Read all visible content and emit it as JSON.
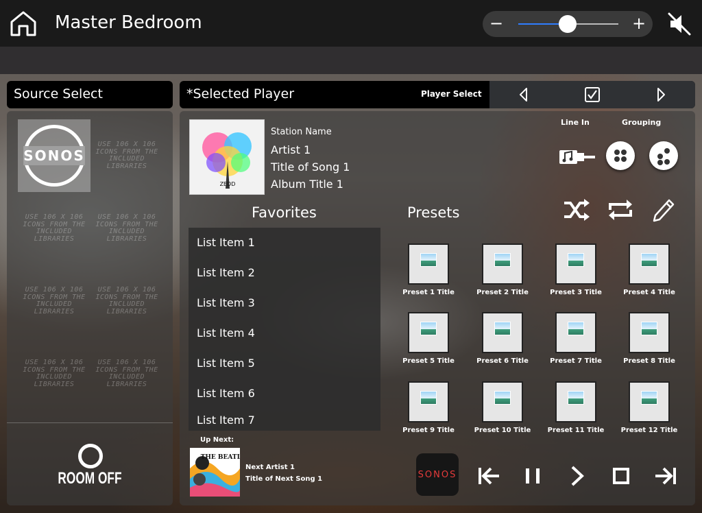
{
  "header": {
    "room_name": "Master Bedroom",
    "volume": {
      "minus": "−",
      "plus": "+",
      "level": 0.49
    }
  },
  "source_select": {
    "title": "Source Select",
    "tiles": [
      "SONOS",
      "USE 106 X 106 ICONS FROM THE INCLUDED LIBRARIES",
      "USE 106 X 106 ICONS FROM THE INCLUDED LIBRARIES",
      "USE 106 X 106 ICONS FROM THE INCLUDED LIBRARIES",
      "USE 106 X 106 ICONS FROM THE INCLUDED LIBRARIES",
      "USE 106 X 106 ICONS FROM THE INCLUDED LIBRARIES",
      "USE 106 X 106 ICONS FROM THE INCLUDED LIBRARIES",
      "USE 106 X 106 ICONS FROM THE INCLUDED LIBRARIES"
    ],
    "room_off": "ROOM OFF"
  },
  "player": {
    "title": "*Selected Player",
    "player_select": "Player Select"
  },
  "now_playing": {
    "album_text": "ZEDD",
    "station": "Station Name",
    "artist": "Artist 1",
    "song": "Title of Song 1",
    "album": "Album Title 1"
  },
  "labels": {
    "line_in": "Line In",
    "grouping": "Grouping"
  },
  "favorites": {
    "title": "Favorites",
    "items": [
      "List Item 1",
      "List Item 2",
      "List Item 3",
      "List Item 4",
      "List Item 5",
      "List Item 6",
      "List Item 7"
    ]
  },
  "presets": {
    "title": "Presets",
    "items": [
      "Preset 1 Title",
      "Preset 2 Title",
      "Preset 3 Title",
      "Preset 4 Title",
      "Preset 5 Title",
      "Preset 6 Title",
      "Preset 7 Title",
      "Preset 8 Title",
      "Preset 9 Title",
      "Preset 10 Title",
      "Preset 11 Title",
      "Preset 12 Title"
    ]
  },
  "up_next": {
    "label": "Up Next:",
    "art_text": "THE BEATLES",
    "artist": "Next Artist 1",
    "song": "Title of Next Song 1"
  },
  "transport": {
    "sonos_label": "SONOS"
  },
  "colors": {
    "accent": "#2f7dff",
    "sonos_red": "#e63b3b"
  }
}
